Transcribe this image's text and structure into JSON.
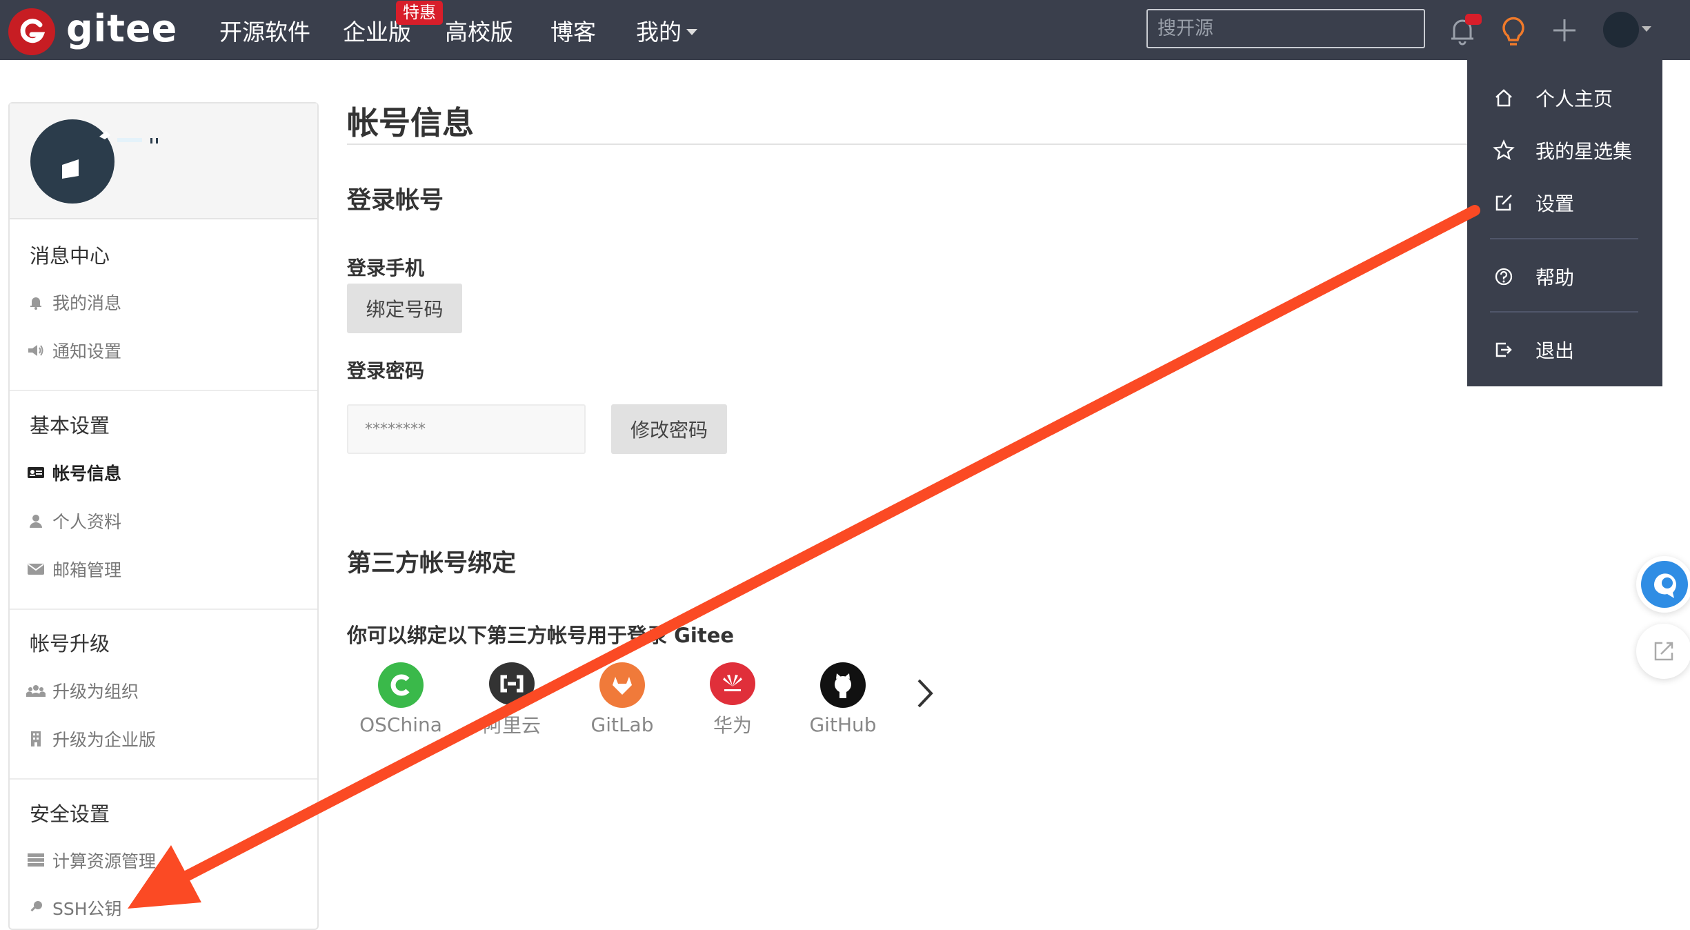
{
  "brand": {
    "name": "gitee",
    "color": "#c71d23"
  },
  "nav": {
    "items": [
      "开源软件",
      "企业版",
      "高校版",
      "博客",
      "我的"
    ],
    "promo_badge": "特惠"
  },
  "search": {
    "placeholder": "搜开源"
  },
  "dropdown": {
    "items": [
      {
        "label": "个人主页",
        "icon": "home-icon"
      },
      {
        "label": "我的星选集",
        "icon": "star-icon"
      },
      {
        "label": "设置",
        "icon": "edit-icon"
      },
      {
        "label": "帮助",
        "icon": "help-icon"
      },
      {
        "label": "退出",
        "icon": "logout-icon"
      }
    ]
  },
  "sidebar": {
    "sections": [
      {
        "heading": "消息中心",
        "items": [
          {
            "label": "我的消息",
            "icon": "bell-icon"
          },
          {
            "label": "通知设置",
            "icon": "megaphone-icon"
          }
        ]
      },
      {
        "heading": "基本设置",
        "items": [
          {
            "label": "帐号信息",
            "icon": "id-card-icon",
            "active": true
          },
          {
            "label": "个人资料",
            "icon": "user-icon"
          },
          {
            "label": "邮箱管理",
            "icon": "envelope-icon"
          }
        ]
      },
      {
        "heading": "帐号升级",
        "items": [
          {
            "label": "升级为组织",
            "icon": "group-icon"
          },
          {
            "label": "升级为企业版",
            "icon": "building-icon"
          }
        ]
      },
      {
        "heading": "安全设置",
        "items": [
          {
            "label": "计算资源管理",
            "icon": "server-icon"
          },
          {
            "label": "SSH公钥",
            "icon": "key-icon"
          }
        ]
      }
    ]
  },
  "main": {
    "title": "帐号信息",
    "login_section": {
      "title": "登录帐号",
      "phone_label": "登录手机",
      "bind_phone_button": "绑定号码",
      "password_label": "登录密码",
      "password_value": "********",
      "change_password_button": "修改密码"
    },
    "third_party": {
      "title": "第三方帐号绑定",
      "description": "你可以绑定以下第三方帐号用于登录 Gitee",
      "providers": [
        {
          "name": "OSChina",
          "color": "#3ab94a"
        },
        {
          "name": "阿里云",
          "color": "#333333"
        },
        {
          "name": "GitLab",
          "color": "#f07a3a"
        },
        {
          "name": "华为",
          "color": "#e02f3a"
        },
        {
          "name": "GitHub",
          "color": "#111111"
        }
      ]
    }
  },
  "annotation": {
    "arrow_color": "#fb4a24"
  }
}
